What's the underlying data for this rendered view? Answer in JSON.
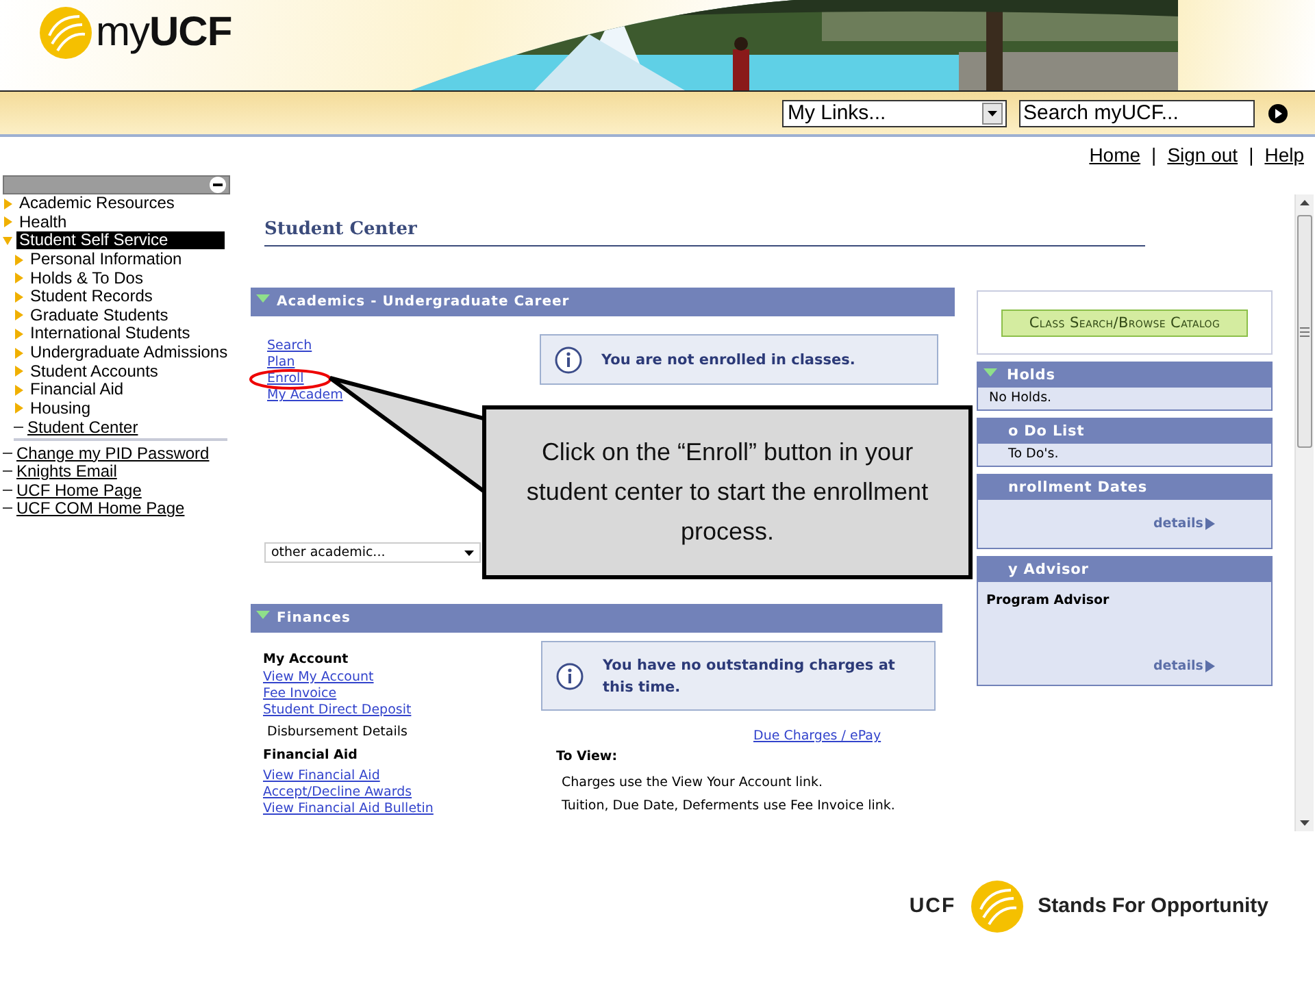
{
  "header": {
    "logo_text": "my**UCF**",
    "links_menu": {
      "value": "My Links..."
    },
    "search": {
      "value": "Search myUCF..."
    }
  },
  "top_links": {
    "items": [
      "Home",
      "Sign out",
      "Help"
    ],
    "separator": "|"
  },
  "sidebar": {
    "items": [
      {
        "label": "Academic Resources",
        "kind": "folder",
        "expanded": false,
        "selected": false
      },
      {
        "label": "Health",
        "kind": "folder",
        "expanded": false,
        "selected": false
      },
      {
        "label": "Student Self Service",
        "kind": "folder",
        "expanded": true,
        "selected": true,
        "children": [
          {
            "label": "Personal Information",
            "kind": "folder",
            "expanded": false,
            "selected": false
          },
          {
            "label": "Holds & To Dos",
            "kind": "folder",
            "expanded": false,
            "selected": false
          },
          {
            "label": "Student Records",
            "kind": "folder",
            "expanded": false,
            "selected": false
          },
          {
            "label": "Graduate Students",
            "kind": "folder",
            "expanded": false,
            "selected": false
          },
          {
            "label": "International Students",
            "kind": "folder",
            "expanded": false,
            "selected": false
          },
          {
            "label": "Undergraduate Admissions",
            "kind": "folder",
            "expanded": false,
            "selected": false
          },
          {
            "label": "Student Accounts",
            "kind": "folder",
            "expanded": false,
            "selected": false
          },
          {
            "label": "Financial Aid",
            "kind": "folder",
            "expanded": false,
            "selected": false
          },
          {
            "label": "Housing",
            "kind": "folder",
            "expanded": false,
            "selected": false
          },
          {
            "label": "Student Center",
            "kind": "link",
            "selected": false
          }
        ]
      },
      {
        "label": "Change my PID Password",
        "kind": "link",
        "selected": false
      },
      {
        "label": "Knights Email",
        "kind": "link",
        "selected": false
      },
      {
        "label": "UCF Home Page",
        "kind": "link",
        "selected": false
      },
      {
        "label": "UCF COM Home Page",
        "kind": "link",
        "selected": false
      }
    ]
  },
  "page_title": "Student Center",
  "academics": {
    "title": "Academics - Undergraduate Career",
    "links": [
      "Search",
      "Plan",
      "Enroll",
      "My Academ"
    ],
    "notice": "You are not enrolled in classes.",
    "dropdown": "other academic..."
  },
  "finances": {
    "title": "Finances",
    "left": [
      {
        "kind": "heading",
        "text": "My Account"
      },
      {
        "kind": "link",
        "text": "View My Account"
      },
      {
        "kind": "link",
        "text": "Fee Invoice"
      },
      {
        "kind": "link",
        "text": "Student Direct Deposit"
      },
      {
        "kind": "text",
        "text": "Disbursement Details"
      },
      {
        "kind": "heading",
        "text": "Financial Aid"
      },
      {
        "kind": "link",
        "text": "View Financial Aid"
      },
      {
        "kind": "link",
        "text": "Accept/Decline Awards"
      },
      {
        "kind": "link",
        "text": "View Financial Aid Bulletin"
      }
    ],
    "notice": "You have no outstanding charges at this time.",
    "pay_link": "Due Charges / ePay",
    "to_view": "To View:",
    "lines": [
      "Charges use the View Your Account link.",
      "Tuition, Due Date, Deferments use Fee Invoice link."
    ]
  },
  "class_search_button": "Class Search/Browse Catalog",
  "panels": [
    {
      "title": "Holds",
      "arrow": true,
      "content": [
        {
          "kind": "text",
          "text": "No Holds."
        }
      ]
    },
    {
      "title": "o Do List",
      "arrow": false,
      "content": [
        {
          "kind": "text",
          "text": "To Do's."
        }
      ]
    },
    {
      "title": "nrollment Dates",
      "arrow": false,
      "content": [
        {
          "kind": "details",
          "text": "details"
        }
      ]
    },
    {
      "title": "y Advisor",
      "arrow": false,
      "content": [
        {
          "kind": "heading",
          "text": "Program Advisor"
        },
        {
          "kind": "details",
          "text": "details"
        }
      ]
    }
  ],
  "callout": {
    "text": "Click on the “Enroll” button in your student center to start the enrollment process."
  },
  "footer": {
    "brand": "UCF",
    "slogan": "Stands For Opportunity"
  }
}
